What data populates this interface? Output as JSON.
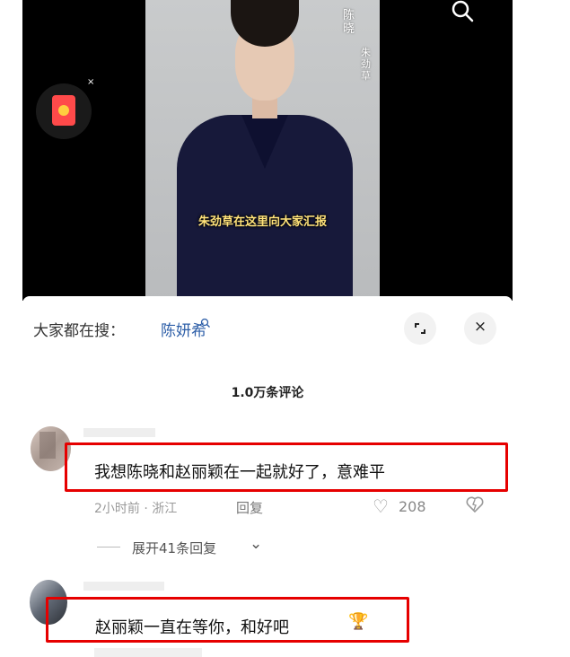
{
  "video": {
    "caption": "朱劲草在这里向大家汇报",
    "vertical_title": "陈晓",
    "vertical_subtitle": "朱劲草",
    "search_icon": "search-icon",
    "red_packet_icon": "red-packet-icon",
    "red_packet_close": "×"
  },
  "comments_sheet": {
    "hot_search_label": "大家都在搜：",
    "hot_search_term": "陈妍希",
    "hot_search_icon": "search-icon",
    "expand_icon": "expand-icon",
    "close_label": "×",
    "comment_count": "1.0万条评论",
    "comments": [
      {
        "text": "我想陈晓和赵丽颖在一起就好了，意难平",
        "time_location": "2小时前 · 浙江",
        "reply_label": "回复",
        "likes": "208",
        "expand_replies": "展开41条回复"
      },
      {
        "text": "赵丽颖一直在等你，和好吧",
        "emoji": "🏆"
      }
    ]
  },
  "colors": {
    "highlight_border": "#e60000",
    "hot_search_term": "#2e5fa8",
    "video_background": "#000000"
  }
}
